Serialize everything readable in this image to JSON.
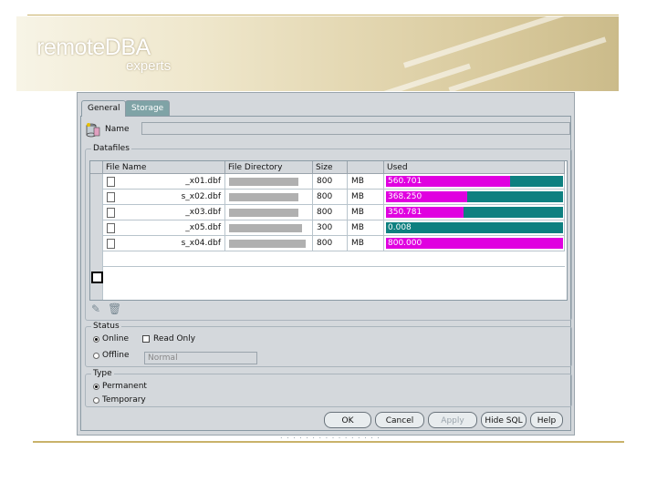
{
  "slide": {
    "logo_main": "remoteDBA",
    "logo_sub": "experts"
  },
  "tabs": [
    {
      "label": "General",
      "active": true
    },
    {
      "label": "Storage",
      "active": false
    }
  ],
  "name_label": "Name",
  "datafiles": {
    "legend": "Datafiles",
    "headers": [
      "File Name",
      "File Directory",
      "Size",
      "",
      "Used"
    ],
    "rows": [
      {
        "name": "_x01.dbf",
        "size": "800",
        "unit": "MB",
        "used": "560.701",
        "used_fraction": 0.7
      },
      {
        "name": "s_x02.dbf",
        "size": "800",
        "unit": "MB",
        "used": "368.250",
        "used_fraction": 0.46
      },
      {
        "name": "_x03.dbf",
        "size": "800",
        "unit": "MB",
        "used": "350.781",
        "used_fraction": 0.44
      },
      {
        "name": "_x05.dbf",
        "size": "300",
        "unit": "MB",
        "used": "0.008",
        "used_fraction": 0.0
      },
      {
        "name": "s_x04.dbf",
        "size": "800",
        "unit": "MB",
        "used": "800.000",
        "used_fraction": 1.0
      }
    ]
  },
  "status": {
    "legend": "Status",
    "online": "Online",
    "read_only": "Read Only",
    "offline": "Offline",
    "offline_mode": "Normal"
  },
  "type": {
    "legend": "Type",
    "permanent": "Permanent",
    "temporary": "Temporary"
  },
  "buttons": {
    "ok": "OK",
    "cancel": "Cancel",
    "apply": "Apply",
    "hide_sql": "Hide SQL",
    "help": "Help"
  },
  "colors": {
    "used_fill": "#e000e0",
    "free_fill": "#0e8080",
    "tab_inactive": "#7fa3a6"
  }
}
